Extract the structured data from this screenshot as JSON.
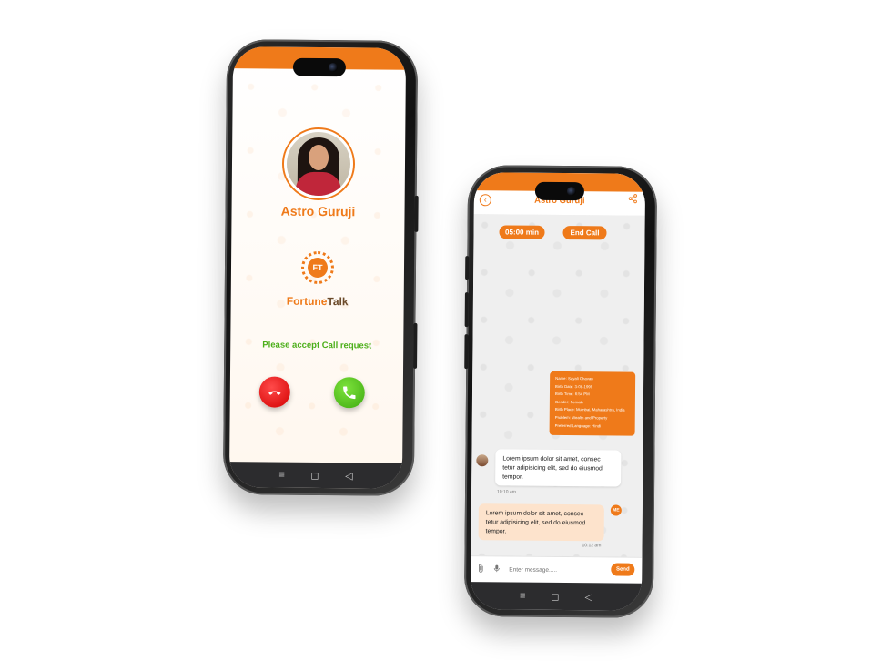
{
  "colors": {
    "brand_orange": "#ef7a1a",
    "accept_green": "#4caf1a",
    "decline_red": "#d30000",
    "nav_dark": "#2c2c2e"
  },
  "incoming_call": {
    "caller_name": "Astro Guruji",
    "logo_initials": "FT",
    "brand_part1": "Fortune",
    "brand_part2": "Talk",
    "status_message": "Please accept Call request",
    "decline_icon": "phone-hangup-icon",
    "accept_icon": "phone-icon"
  },
  "chat": {
    "title": "Astro Guruji",
    "back_icon": "back-arrow-icon",
    "share_icon": "share-icon",
    "timer": "05:00 min",
    "end_call": "End Call",
    "user_details": [
      "Name: Sayali Chavan",
      "Birth Date: 3-08-1999",
      "Birth Time: 6:54 PM",
      "Gender: Female",
      "Birth Place: Mumbai, Maharashtra, India",
      "Problem: Wealth and Property",
      "Preferred Language: Hindi"
    ],
    "messages": [
      {
        "text": "Lorem ipsum dolor sit amet, consec tetur adipisicing elit, sed do eiusmod tempor.",
        "time": "10:10 am"
      },
      {
        "text": "Lorem ipsum dolor sit amet, consec tetur adipisicing elit, sed do eiusmod tempor.",
        "time": "10:12 am",
        "badge": "ME"
      }
    ],
    "input_placeholder": "Enter message.....",
    "send_label": "Send"
  },
  "nav": {
    "menu": "≡",
    "home": "◻",
    "back": "◁"
  }
}
